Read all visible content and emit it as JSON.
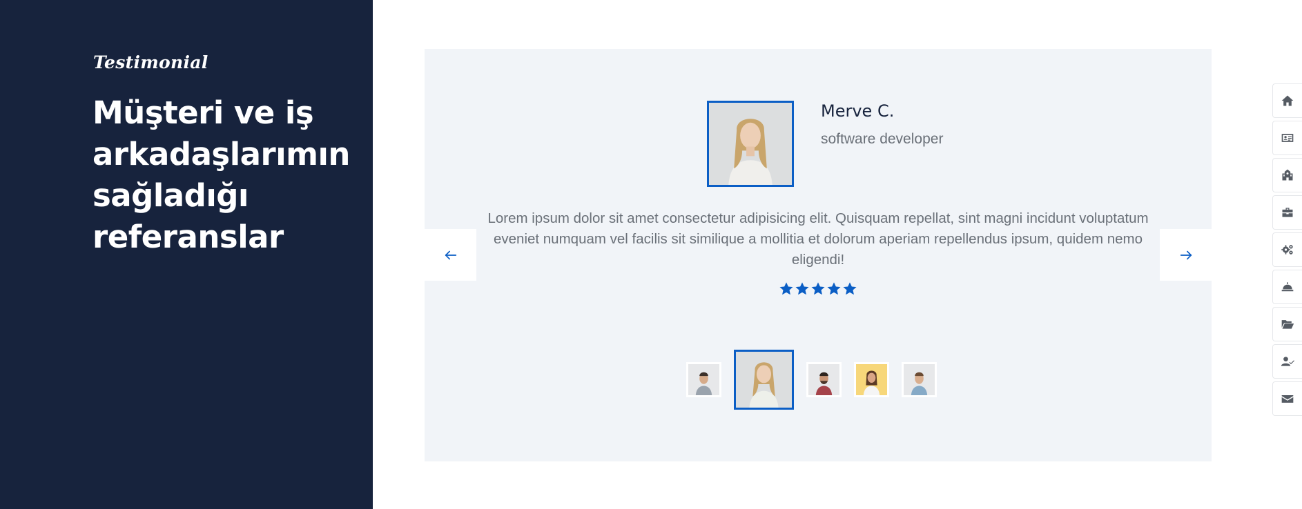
{
  "hero": {
    "eyebrow": "Testimonial",
    "heading": "Müşteri ve iş arkadaşlarımın sağladığı referanslar"
  },
  "testimonial": {
    "name": "Merve C.",
    "role": "software developer",
    "quote": "Lorem ipsum dolor sit amet consectetur adipisicing elit. Quisquam repellat, sint magni incidunt voluptatum eveniet numquam vel facilis sit similique a mollitia et dolorum aperiam repellendus ipsum, quidem nemo eligendi!",
    "rating": 5,
    "rating_max": 5
  },
  "carousel": {
    "prev_icon": "arrow-left-icon",
    "next_icon": "arrow-right-icon",
    "active_index": 1,
    "thumbnail_count": 5
  },
  "side_menu": {
    "items": [
      {
        "icon": "home-icon"
      },
      {
        "icon": "id-card-icon"
      },
      {
        "icon": "building-icon"
      },
      {
        "icon": "briefcase-icon"
      },
      {
        "icon": "gears-icon"
      },
      {
        "icon": "service-bell-icon"
      },
      {
        "icon": "folder-open-icon"
      },
      {
        "icon": "user-check-icon"
      },
      {
        "icon": "envelope-icon"
      }
    ]
  },
  "colors": {
    "panel": "#17233d",
    "accent": "#0b5ec5",
    "card": "#f1f4f8",
    "muted_text": "#6a7078"
  }
}
